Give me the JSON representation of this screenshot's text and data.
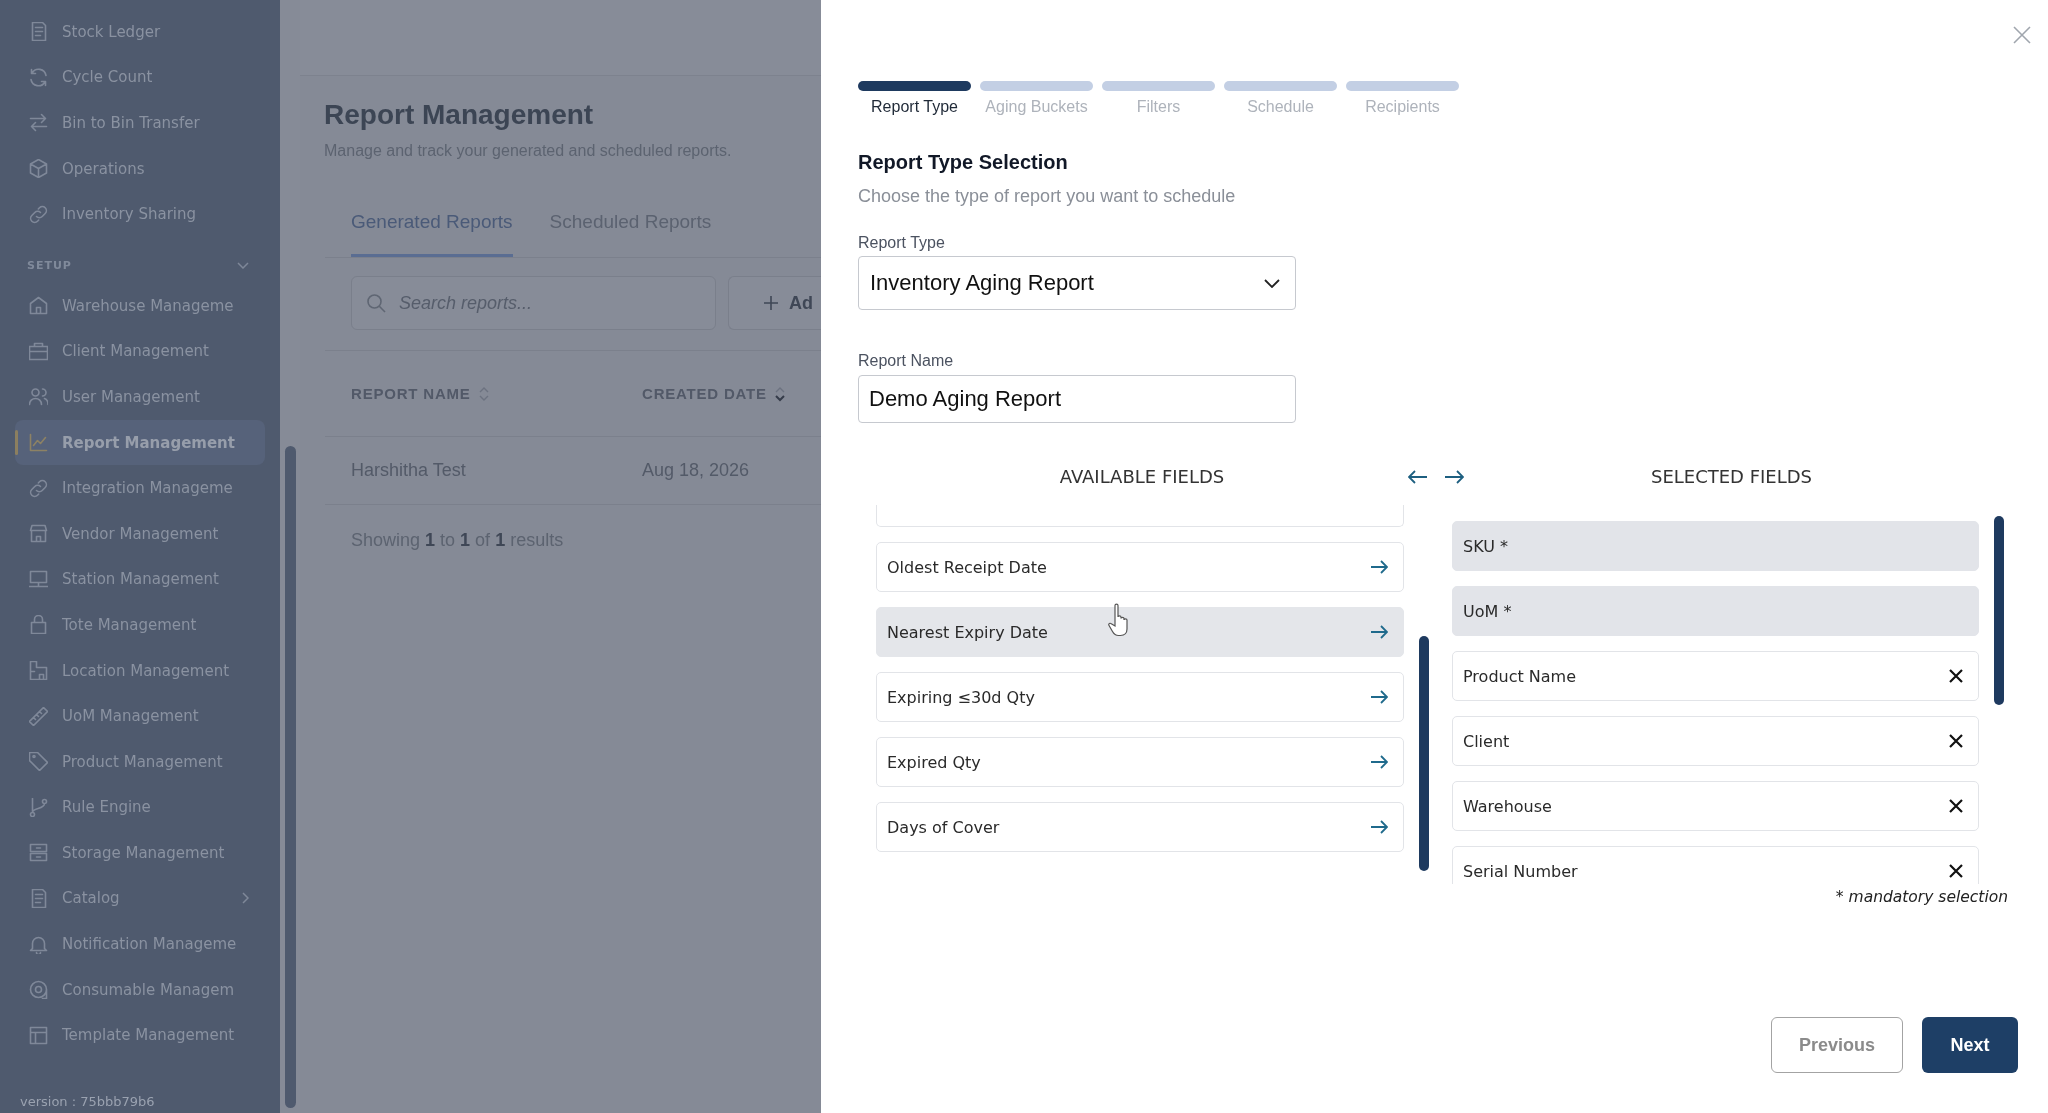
{
  "sidebar": {
    "sections": [
      {
        "items": [
          {
            "label": "Stock Ledger",
            "kind": "link",
            "selected": false
          },
          {
            "label": "Cycle Count",
            "kind": "link",
            "selected": false
          },
          {
            "label": "Bin to Bin Transfer",
            "kind": "link",
            "selected": false
          },
          {
            "label": "Operations",
            "kind": "link",
            "selected": false
          },
          {
            "label": "Inventory Sharing",
            "kind": "link",
            "selected": false
          }
        ]
      },
      {
        "title": "SETUP",
        "expanded": true,
        "items": [
          {
            "label": "Warehouse Manageme",
            "kind": "link",
            "selected": false
          },
          {
            "label": "Client Management",
            "kind": "link",
            "selected": false
          },
          {
            "label": "User Management",
            "kind": "link",
            "selected": false
          },
          {
            "label": "Report Management",
            "kind": "link",
            "selected": true
          },
          {
            "label": "Integration Manageme",
            "kind": "link",
            "selected": false
          },
          {
            "label": "Vendor Management",
            "kind": "link",
            "selected": false
          },
          {
            "label": "Station Management",
            "kind": "link",
            "selected": false
          },
          {
            "label": "Tote Management",
            "kind": "link",
            "selected": false
          },
          {
            "label": "Location Management",
            "kind": "link",
            "selected": false
          },
          {
            "label": "UoM Management",
            "kind": "link",
            "selected": false
          },
          {
            "label": "Product Management",
            "kind": "link",
            "selected": false
          },
          {
            "label": "Rule Engine",
            "kind": "link",
            "selected": false
          },
          {
            "label": "Storage Management",
            "kind": "link",
            "selected": false
          },
          {
            "label": "Catalog",
            "kind": "group",
            "selected": false,
            "expanded": false
          },
          {
            "label": "Notification Manageme",
            "kind": "link",
            "selected": false
          },
          {
            "label": "Consumable Managem",
            "kind": "link",
            "selected": false
          },
          {
            "label": "Template Management",
            "kind": "link",
            "selected": false
          }
        ]
      }
    ],
    "version": "version : 75bbb79b6"
  },
  "page": {
    "title": "Report Management",
    "subtitle": "Manage and track your generated and scheduled reports.",
    "tabs": [
      {
        "label": "Generated Reports",
        "selected": true
      },
      {
        "label": "Scheduled Reports",
        "selected": false
      }
    ],
    "search": {
      "placeholder": "Search reports..."
    },
    "add_button": {
      "label": "Ad"
    },
    "table": {
      "columns": [
        {
          "label": "REPORT NAME",
          "sorted_descending": false
        },
        {
          "label": "CREATED DATE",
          "sorted_descending": true
        }
      ],
      "rows": [
        [
          "Harshitha Test",
          "Aug 18, 2026"
        ]
      ]
    },
    "pagination": "Showing **1** to **1** of **1** results"
  },
  "modal": {
    "steps": [
      {
        "label": "Report Type",
        "selected": true
      },
      {
        "label": "Aging Buckets",
        "selected": false
      },
      {
        "label": "Filters",
        "selected": false
      },
      {
        "label": "Schedule",
        "selected": false
      },
      {
        "label": "Recipients",
        "selected": false
      }
    ],
    "title": "Report Type Selection",
    "subtitle": "Choose the type of report you want to schedule",
    "report_type": {
      "label": "Report Type",
      "value": "Inventory Aging Report"
    },
    "report_name": {
      "label": "Report Name",
      "value": "Demo Aging Report"
    },
    "available_fields": {
      "title": "AVAILABLE FIELDS",
      "items": [
        {
          "label": "Oldest Receipt Date",
          "hovered": false
        },
        {
          "label": "Nearest Expiry Date",
          "hovered": true
        },
        {
          "label": "Expiring ≤30d Qty",
          "hovered": false
        },
        {
          "label": "Expired Qty",
          "hovered": false
        },
        {
          "label": "Days of Cover",
          "hovered": false
        }
      ]
    },
    "selected_fields": {
      "title": "SELECTED FIELDS",
      "items": [
        {
          "label": "SKU *",
          "mandatory": true
        },
        {
          "label": "UoM *",
          "mandatory": true
        },
        {
          "label": "Product Name",
          "mandatory": false
        },
        {
          "label": "Client",
          "mandatory": false
        },
        {
          "label": "Warehouse",
          "mandatory": false
        },
        {
          "label": "Serial Number",
          "mandatory": false
        }
      ]
    },
    "footnote": "* mandatory selection",
    "buttons": [
      {
        "label": "Previous",
        "kind": "secondary"
      },
      {
        "label": "Next",
        "kind": "primary"
      }
    ]
  }
}
